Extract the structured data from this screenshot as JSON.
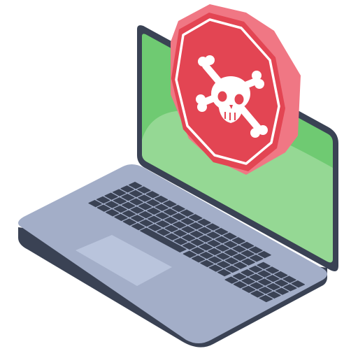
{
  "illustration": {
    "subject": "laptop-with-skull-warning-sign",
    "icons": [
      "laptop-icon",
      "stop-sign-icon",
      "skull-crossbones-icon",
      "keyboard",
      "touchpad"
    ]
  },
  "colors": {
    "laptop_outline": "#3a4254",
    "laptop_body": "#a3aec8",
    "laptop_side": "#3a4254",
    "keys": "#3a4254",
    "touchpad": "#b9c4dc",
    "screen_bezel": "#3a4254",
    "screen_green_dark": "#6fca72",
    "screen_green_light": "#95d894",
    "sign_red": "#e34553",
    "sign_red_side": "#f07784",
    "sign_ring": "#ffffff",
    "skull": "#ffffff"
  }
}
